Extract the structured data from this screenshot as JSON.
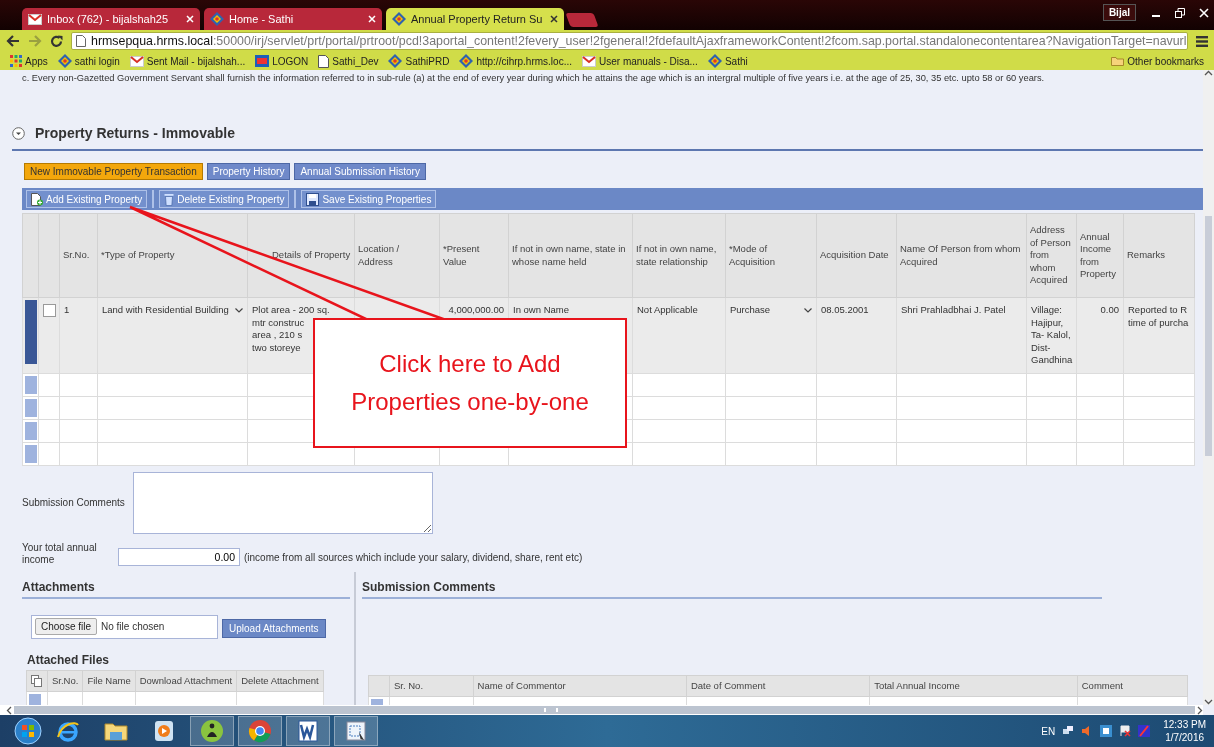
{
  "browser": {
    "tabs": [
      {
        "title": "Inbox (762) - bijalshah25",
        "kind": "mail",
        "selected": false
      },
      {
        "title": "Home - Sathi",
        "kind": "sathi",
        "selected": false
      },
      {
        "title": "Annual Property Return Su",
        "kind": "sathi",
        "selected": true
      }
    ],
    "user": "Bijal",
    "url_host": "hrmsepqua.hrms.local",
    "url_path": ":50000/irj/servlet/prt/portal/prtroot/pcd!3aportal_content!2fevery_user!2fgeneral!2fdefaultAjaxframeworkContent!2fcom.sap.portal.standalonecontentarea?NavigationTarget=navurl",
    "bookmarks": [
      {
        "label": "Apps",
        "kind": "apps"
      },
      {
        "label": "sathi login",
        "kind": "sathi"
      },
      {
        "label": "Sent Mail - bijalshah...",
        "kind": "mail"
      },
      {
        "label": "LOGON",
        "kind": "logon"
      },
      {
        "label": "Sathi_Dev",
        "kind": "page"
      },
      {
        "label": "SathiPRD",
        "kind": "sathi"
      },
      {
        "label": "http://cihrp.hrms.loc...",
        "kind": "sathi"
      },
      {
        "label": "User manuals - Disa...",
        "kind": "mail"
      },
      {
        "label": "Sathi",
        "kind": "sathi"
      }
    ],
    "other_bookmarks": "Other bookmarks"
  },
  "portal": {
    "notice": "c. Every non-Gazetted Government Servant shall furnish the information referred to in sub-rule (a) at the end of every year during which he attains the age which is an intergral multiple of five years i.e. at the age of 25, 30, 35 etc. upto 58 or 60 years.",
    "section_title": "Property Returns - Immovable",
    "actions": [
      {
        "label": "New Immovable Property Transaction",
        "kind": "primary"
      },
      {
        "label": "Property History",
        "kind": "secondary"
      },
      {
        "label": "Annual Submission History",
        "kind": "secondary"
      }
    ],
    "toolbar": [
      {
        "label": "Add Existing Property",
        "kind": "add"
      },
      {
        "label": "Delete Existing Property",
        "kind": "delete"
      },
      {
        "label": "Save Existing Properties",
        "kind": "save"
      }
    ],
    "table": {
      "columns": [
        "Sr.No.",
        "*Type of Property",
        "Details of Property",
        "Location / Address",
        "*Present Value",
        "If not in own name, state in whose name held",
        "If not in own name, state relationship",
        "*Mode of Acquisition",
        "Acquisition Date",
        "Name Of Person from whom Acquired",
        "Address of Person from whom Acquired",
        "Annual Income from Property",
        "Remarks"
      ],
      "rows": [
        {
          "selected": true,
          "checked": false,
          "cells": [
            {
              "kind": "text",
              "value": "1"
            },
            {
              "kind": "select",
              "value": "Land with Residential Building"
            },
            {
              "kind": "lines",
              "lines": [
                "Plot area - 200 sq.",
                "mtr construc",
                "area , 210 s",
                "two storeye"
              ]
            },
            {
              "kind": "blank"
            },
            {
              "kind": "number",
              "value": "4,000,000.00"
            },
            {
              "kind": "text",
              "value": "In own Name"
            },
            {
              "kind": "text",
              "value": "Not Applicable"
            },
            {
              "kind": "select",
              "value": "Purchase"
            },
            {
              "kind": "text",
              "value": "08.05.2001"
            },
            {
              "kind": "text",
              "value": "Shri Prahladbhai J. Patel"
            },
            {
              "kind": "lines",
              "lines": [
                "Village:",
                "Hajipur,",
                "Ta- Kalol,",
                "Dist-",
                "Gandhina"
              ]
            },
            {
              "kind": "number",
              "value": "0.00"
            },
            {
              "kind": "lines",
              "lines": [
                "Reported to R",
                "time of purcha"
              ]
            }
          ]
        }
      ],
      "empty_rows": [
        {
          "selected": false
        },
        {
          "selected": false
        },
        {
          "selected": false
        },
        {
          "selected": false
        }
      ]
    },
    "comments_label": "Submission Comments",
    "income_label": "Your total annual income",
    "income_value": "0.00",
    "income_note": "(income from all sources which include your salary, dividend, share, rent etc)",
    "attachments": {
      "title": "Attachments",
      "choose_button": "Choose file",
      "file_status": "No file chosen",
      "upload_button": "Upload Attachments",
      "files_title": "Attached Files",
      "columns": [
        "Sr.No.",
        "File Name",
        "Download Attachment",
        "Delete Attachment"
      ],
      "empty_rows": [
        {
          "selected": false
        }
      ]
    },
    "comments": {
      "title": "Submission Comments",
      "columns": [
        "Sr. No.",
        "Name of Commentor",
        "Date of Comment",
        "Total Annual Income",
        "Comment"
      ],
      "empty_rows": [
        {
          "selected": false
        }
      ]
    }
  },
  "callout": {
    "text": "Click here to Add Properties one-by-one"
  },
  "taskbar": {
    "apps": [
      {
        "kind": "ie"
      },
      {
        "kind": "folder"
      },
      {
        "kind": "media"
      },
      {
        "kind": "meditation"
      },
      {
        "kind": "chrome"
      },
      {
        "kind": "word"
      },
      {
        "kind": "snip"
      }
    ],
    "language": "EN",
    "time": "12:33 PM",
    "date": "1/7/2016"
  }
}
